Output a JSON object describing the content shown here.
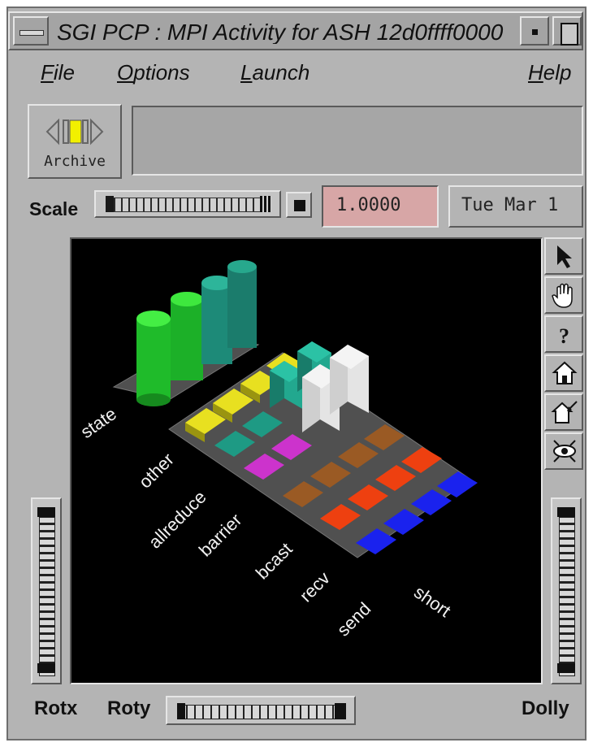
{
  "window": {
    "title": "SGI PCP : MPI Activity for ASH 12d0ffff0000"
  },
  "menu": {
    "file": "File",
    "options": "Options",
    "launch": "Launch",
    "help": "Help"
  },
  "archive": {
    "label": "Archive"
  },
  "scale": {
    "label": "Scale",
    "value": "1.0000"
  },
  "date": {
    "text": "Tue Mar 1"
  },
  "scene": {
    "row_labels": [
      "state",
      "other",
      "allreduce",
      "barrier",
      "bcast",
      "recv",
      "send",
      "short"
    ]
  },
  "controls": {
    "rotx": "Rotx",
    "roty": "Roty",
    "dolly": "Dolly"
  },
  "tools": [
    "select-arrow-icon",
    "hand-icon",
    "help-question-icon",
    "home-icon",
    "set-home-icon",
    "view-all-eye-icon"
  ],
  "colors": {
    "background": "#b4b4b4",
    "viewer": "#000000",
    "green": "#22cc33",
    "teal": "#1e9a84",
    "yellow": "#e8e020",
    "magenta": "#cc33cc",
    "brown": "#9a5a24",
    "orange": "#ee4010",
    "blue": "#1a22ee",
    "white": "#e4e4e4"
  }
}
